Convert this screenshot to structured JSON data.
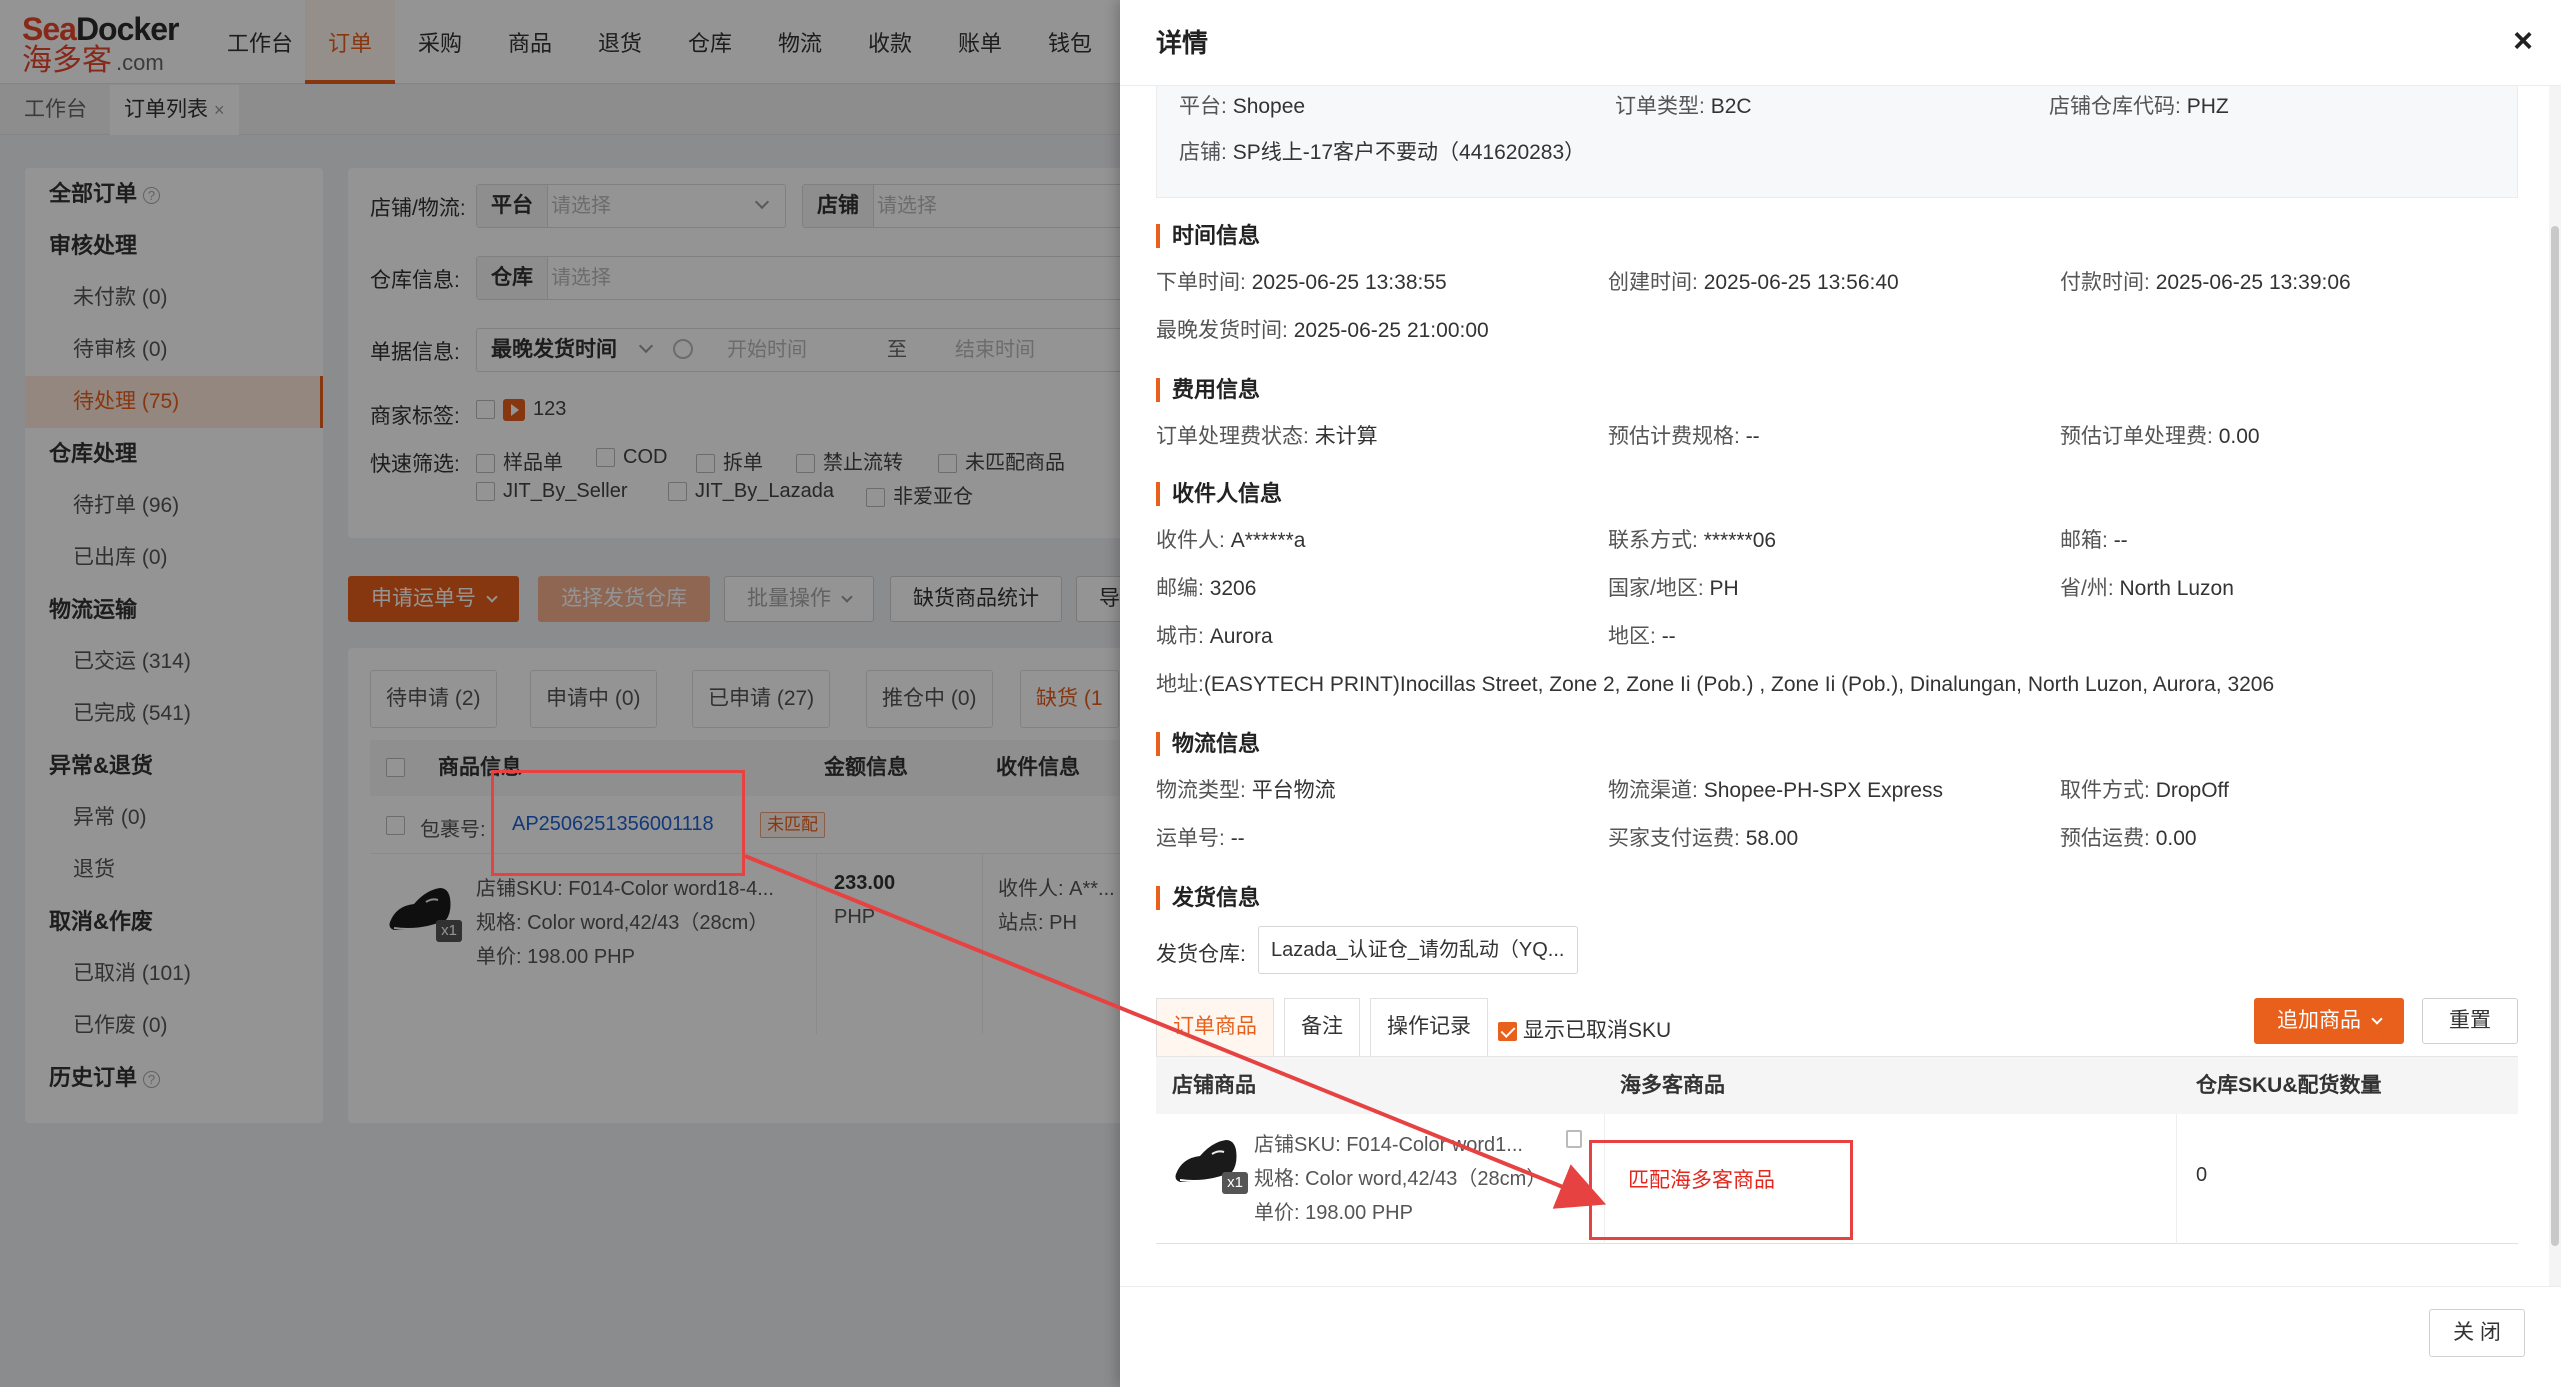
{
  "logo": {
    "brand_top_a": "Sea",
    "brand_top_b": "Docker",
    "brand_cn": "海多客",
    "brand_domain": ".com"
  },
  "nav": [
    "工作台",
    "订单",
    "采购",
    "商品",
    "退货",
    "仓库",
    "物流",
    "收款",
    "账单",
    "钱包"
  ],
  "page_tabs": {
    "home": "工作台",
    "orders": "订单列表",
    "close": "×"
  },
  "sidebar": {
    "all_orders": "全部订单",
    "review": "审核处理",
    "unpaid": "未付款 (0)",
    "pending_review": "待审核 (0)",
    "pending_process": "待处理 (75)",
    "warehouse": "仓库处理",
    "to_print": "待打单 (96)",
    "shipped_out": "已出库 (0)",
    "logistics": "物流运输",
    "delivered": "已交运 (314)",
    "completed": "已完成 (541)",
    "exception_return": "异常&退货",
    "exception": "异常 (0)",
    "returned": "退货",
    "cancel_void": "取消&作废",
    "cancelled": "已取消 (101)",
    "voided": "已作废 (0)",
    "history": "历史订单",
    "help": "?"
  },
  "filter": {
    "shop_logistics_label": "店铺/物流:",
    "platform_key": "平台",
    "platform_ph": "请选择",
    "shop_key": "店铺",
    "shop_ph": "请选择",
    "warehouse_label": "仓库信息:",
    "warehouse_key": "仓库",
    "warehouse_ph": "请选择",
    "order_label": "单据信息:",
    "time_key": "最晚发货时间",
    "start_ph": "开始时间",
    "to": "至",
    "end_ph": "结束时间",
    "merchant_tag_label": "商家标签:",
    "tag_count": "123",
    "quick_label": "快速筛选:",
    "quick_1": "样品单",
    "quick_2": "COD",
    "quick_3": "拆单",
    "quick_4": "禁止流转",
    "quick_5": "未匹配商品",
    "quick_6": "JIT_By_Seller",
    "quick_7": "JIT_By_Lazada",
    "quick_8": "非爱亚仓"
  },
  "actions": {
    "apply_waybill": "申请运单号",
    "select_warehouse": "选择发货仓库",
    "batch": "批量操作",
    "shortage_stats": "缺货商品统计",
    "more": "导"
  },
  "order_tabs": [
    "待申请 (2)",
    "申请中 (0)",
    "已申请 (27)",
    "推仓中 (0)",
    "缺货 (1"
  ],
  "order_table": {
    "col_goods": "商品信息",
    "col_amount": "金额信息",
    "col_receiver": "收件信息",
    "pkg_label": "包裹号:",
    "pkg_no": "AP2506251356001118",
    "pkg_tag": "未匹配",
    "sku": "店铺SKU:  F014-Color word18-4...",
    "spec": "规格:  Color word,42/43（28cm）",
    "price": "单价:  198.00 PHP",
    "qty": "x1",
    "amount": "233.00",
    "currency": "PHP",
    "receiver": "收件人:  A**...",
    "site": "站点:  PH"
  },
  "drawer": {
    "title": "详情",
    "close_icon": "×",
    "basic": {
      "platform_k": "平台:",
      "platform_v": "Shopee",
      "type_k": "订单类型:",
      "type_v": "B2C",
      "wh_code_k": "店铺仓库代码:",
      "wh_code_v": "PHZ",
      "shop_k": "店铺:",
      "shop_v": "SP线上-17客户不要动（441620283）"
    },
    "time": {
      "title": "时间信息",
      "order_k": "下单时间:",
      "order_v": "2025-06-25 13:38:55",
      "create_k": "创建时间:",
      "create_v": "2025-06-25 13:56:40",
      "pay_k": "付款时间:",
      "pay_v": "2025-06-25 13:39:06",
      "latest_k": "最晚发货时间:",
      "latest_v": "2025-06-25 21:00:00"
    },
    "fee": {
      "title": "费用信息",
      "status_k": "订单处理费状态:",
      "status_v": "未计算",
      "rule_k": "预估计费规格:",
      "rule_v": "--",
      "est_k": "预估订单处理费:",
      "est_v": "0.00"
    },
    "receiver": {
      "title": "收件人信息",
      "name_k": "收件人:",
      "name_v": "A******a",
      "phone_k": "联系方式:",
      "phone_v": "******06",
      "email_k": "邮箱:",
      "email_v": "--",
      "zip_k": "邮编:",
      "zip_v": "3206",
      "country_k": "国家/地区:",
      "country_v": "PH",
      "province_k": "省/州:",
      "province_v": "North Luzon",
      "city_k": "城市:",
      "city_v": "Aurora",
      "district_k": "地区:",
      "district_v": "--",
      "addr_k": "地址:",
      "addr_v": "(EASYTECH PRINT)Inocillas Street, Zone 2, Zone Ii (Pob.) , Zone Ii (Pob.), Dinalungan, North Luzon, Aurora, 3206"
    },
    "logistics": {
      "title": "物流信息",
      "type_k": "物流类型:",
      "type_v": "平台物流",
      "channel_k": "物流渠道:",
      "channel_v": "Shopee-PH-SPX Express",
      "pickup_k": "取件方式:",
      "pickup_v": "DropOff",
      "waybill_k": "运单号:",
      "waybill_v": "--",
      "buyer_fee_k": "买家支付运费:",
      "buyer_fee_v": "58.00",
      "est_fee_k": "预估运费:",
      "est_fee_v": "0.00"
    },
    "shipping": {
      "title": "发货信息",
      "wh_k": "发货仓库:",
      "wh_v": "Lazada_认证仓_请勿乱动（YQ..."
    },
    "tabs": {
      "goods": "订单商品",
      "note": "备注",
      "log": "操作记录",
      "show_cancelled": "显示已取消SKU",
      "add_goods": "追加商品",
      "reset": "重置"
    },
    "goods_table": {
      "col_shop": "店铺商品",
      "col_hdk": "海多客商品",
      "col_wh": "仓库SKU&配货数量",
      "sku": "店铺SKU:  F014-Color word1...",
      "spec": "规格:  Color word,42/43（28cm）",
      "price": "单价:  198.00 PHP",
      "qty": "x1",
      "match": "匹配海多客商品",
      "wh_qty": "0"
    },
    "footer_close": "关 闭"
  },
  "colors": {
    "accent": "#e8601c",
    "annotation": "#e64242",
    "link": "#1e62d0"
  }
}
